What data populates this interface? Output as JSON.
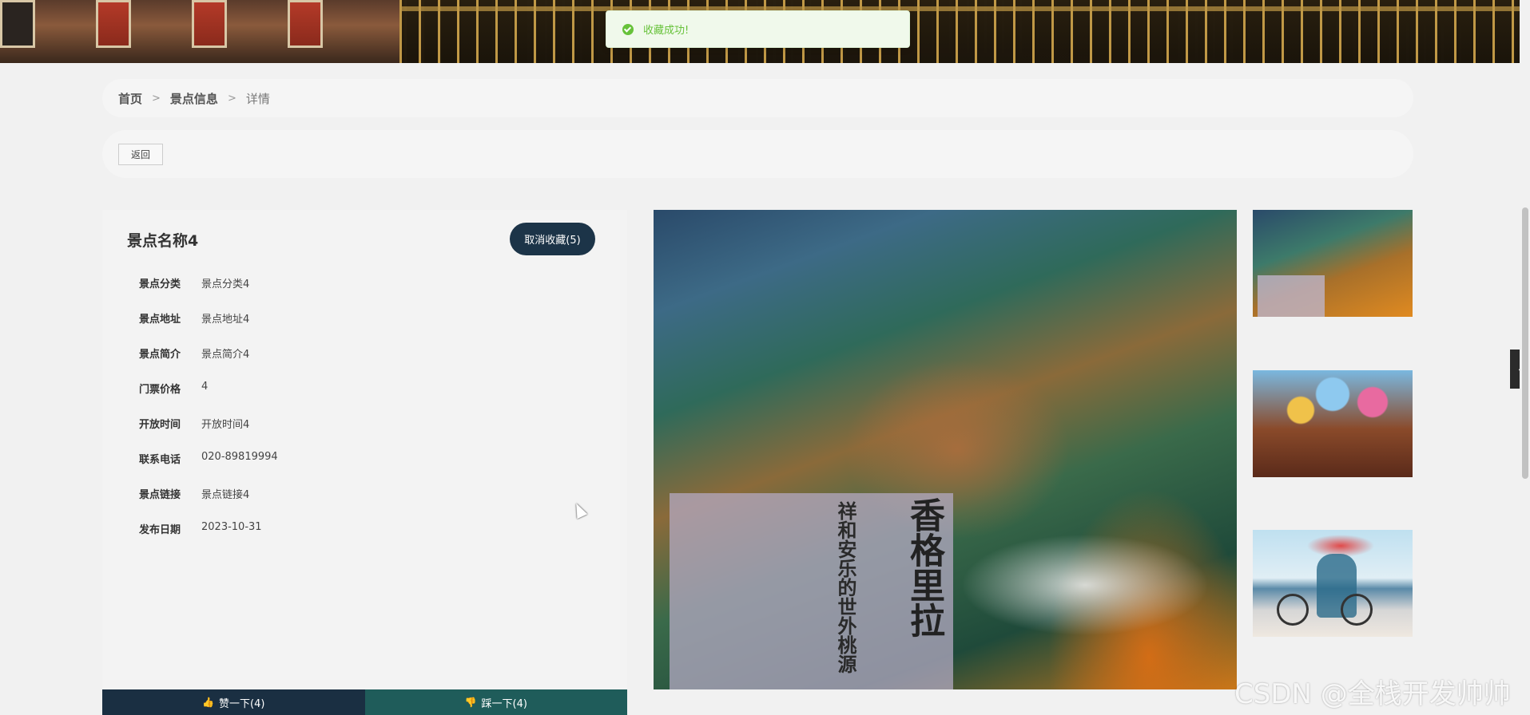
{
  "toast": {
    "message": "收藏成功!",
    "icon": "check-circle-icon",
    "color": "#67c23a"
  },
  "breadcrumb": {
    "items": [
      "首页",
      "景点信息",
      "详情"
    ],
    "separator": ">"
  },
  "actions": {
    "back_label": "返回"
  },
  "detail": {
    "title": "景点名称4",
    "favorite_label": "取消收藏(5)",
    "fields": [
      {
        "label": "景点分类",
        "value": "景点分类4"
      },
      {
        "label": "景点地址",
        "value": "景点地址4"
      },
      {
        "label": "景点简介",
        "value": "景点简介4"
      },
      {
        "label": "门票价格",
        "value": "4"
      },
      {
        "label": "开放时间",
        "value": "开放时间4"
      },
      {
        "label": "联系电话",
        "value": "020-89819994"
      },
      {
        "label": "景点链接",
        "value": "景点链接4"
      },
      {
        "label": "发布日期",
        "value": "2023-10-31"
      }
    ],
    "like_label": "赞一下(4)",
    "dislike_label": "踩一下(4)"
  },
  "gallery": {
    "main_caption": "祥和安乐的世外桃源",
    "main_title": "香格里拉"
  },
  "watermark": "CSDN @全栈开发帅帅",
  "colors": {
    "primary_dark": "#1c3448",
    "like_bg": "#1a2f42",
    "dislike_bg": "#1f5c5a",
    "panel_bg": "#f3f3f3",
    "page_bg": "#f1f1f1"
  }
}
